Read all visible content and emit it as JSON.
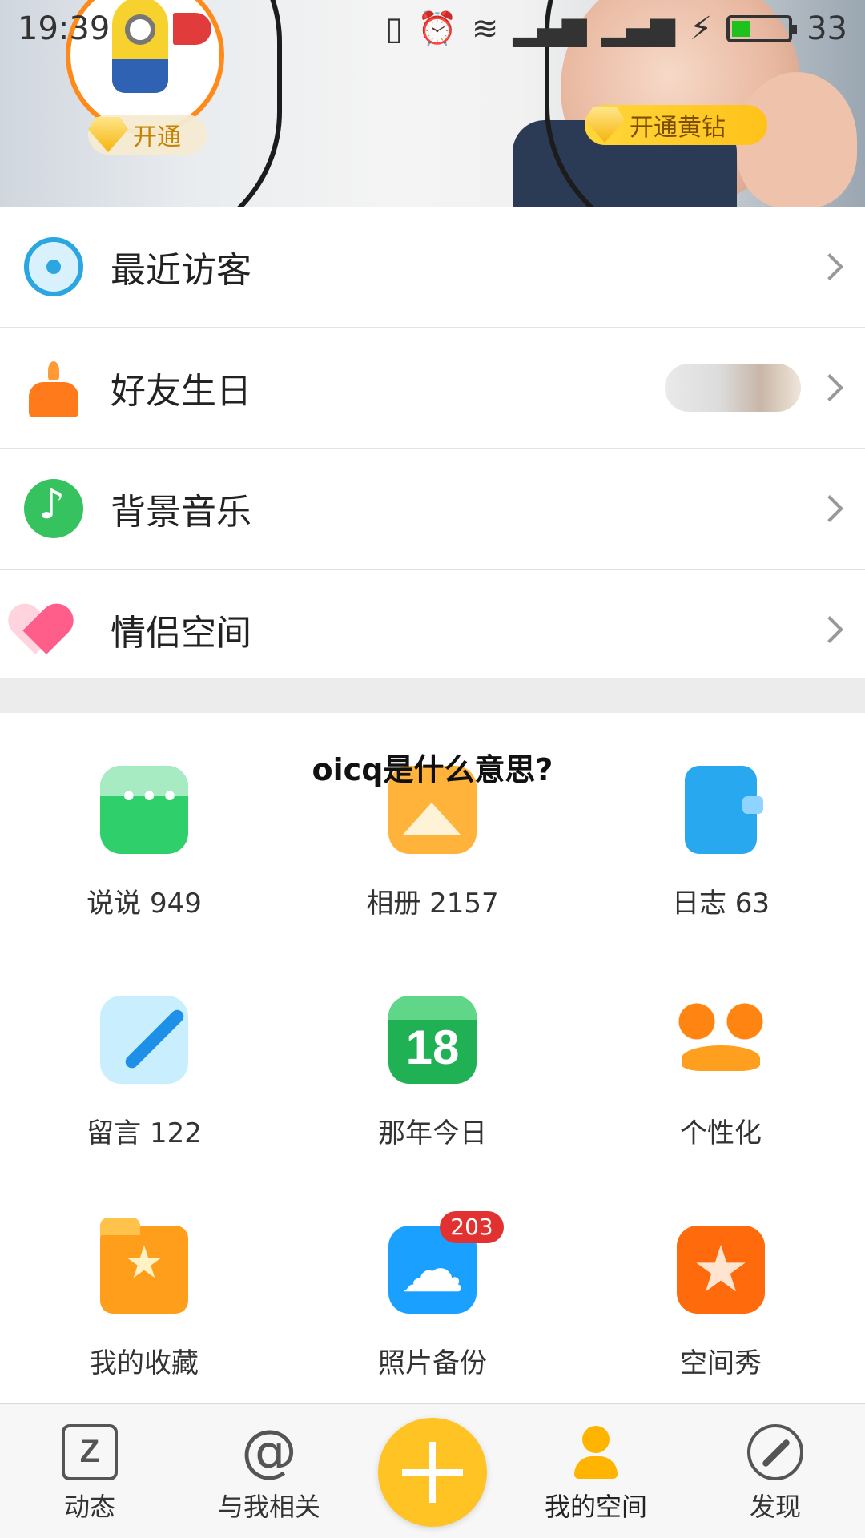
{
  "status_bar": {
    "time": "19:39",
    "battery_level": "33"
  },
  "header": {
    "open_pill": "开通",
    "yellow_diamond_pill": "开通黄钻"
  },
  "menu": [
    {
      "label": "最近访客",
      "icon": "eye-icon"
    },
    {
      "label": "好友生日",
      "icon": "cake-icon"
    },
    {
      "label": "背景音乐",
      "icon": "music-note-icon"
    },
    {
      "label": "情侣空间",
      "icon": "hearts-icon"
    }
  ],
  "overlay_title": "oicq是什么意思?",
  "grid": [
    {
      "label": "说说 949",
      "icon": "chat-bubble-icon"
    },
    {
      "label": "相册 2157",
      "icon": "photo-album-icon"
    },
    {
      "label": "日志 63",
      "icon": "diary-icon"
    },
    {
      "label": "留言 122",
      "icon": "pen-icon"
    },
    {
      "label": "那年今日",
      "icon": "calendar-icon",
      "date": "18"
    },
    {
      "label": "个性化",
      "icon": "mustache-glasses-icon"
    },
    {
      "label": "我的收藏",
      "icon": "folder-star-icon"
    },
    {
      "label": "照片备份",
      "icon": "cloud-backup-icon",
      "badge": "203"
    },
    {
      "label": "空间秀",
      "icon": "star-show-icon"
    }
  ],
  "bottom_nav": [
    {
      "label": "动态",
      "icon": "z-star-icon"
    },
    {
      "label": "与我相关",
      "icon": "at-icon"
    },
    {
      "label": "我的空间",
      "icon": "person-icon",
      "active": true
    },
    {
      "label": "发现",
      "icon": "compass-icon"
    }
  ],
  "colors": {
    "accent_yellow": "#ffc323",
    "badge_red": "#e23131",
    "battery_green": "#1ec21e"
  }
}
